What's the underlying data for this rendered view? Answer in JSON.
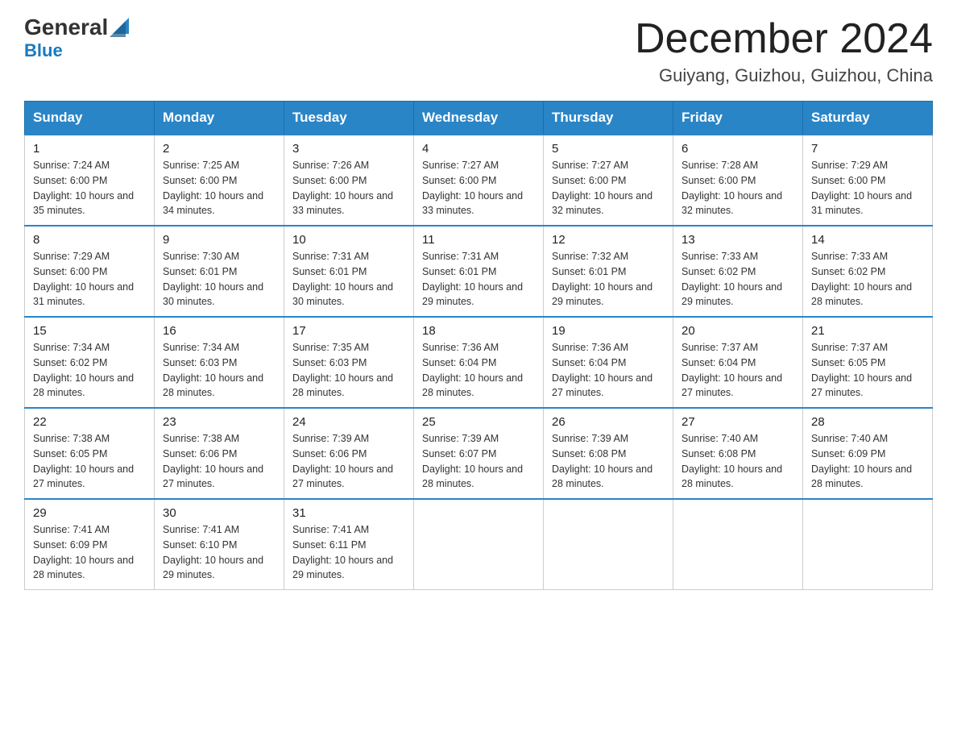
{
  "header": {
    "logo_general": "General",
    "logo_blue": "Blue",
    "month_title": "December 2024",
    "location": "Guiyang, Guizhou, Guizhou, China"
  },
  "days_of_week": [
    "Sunday",
    "Monday",
    "Tuesday",
    "Wednesday",
    "Thursday",
    "Friday",
    "Saturday"
  ],
  "weeks": [
    [
      {
        "day": "1",
        "sunrise": "7:24 AM",
        "sunset": "6:00 PM",
        "daylight": "10 hours and 35 minutes."
      },
      {
        "day": "2",
        "sunrise": "7:25 AM",
        "sunset": "6:00 PM",
        "daylight": "10 hours and 34 minutes."
      },
      {
        "day": "3",
        "sunrise": "7:26 AM",
        "sunset": "6:00 PM",
        "daylight": "10 hours and 33 minutes."
      },
      {
        "day": "4",
        "sunrise": "7:27 AM",
        "sunset": "6:00 PM",
        "daylight": "10 hours and 33 minutes."
      },
      {
        "day": "5",
        "sunrise": "7:27 AM",
        "sunset": "6:00 PM",
        "daylight": "10 hours and 32 minutes."
      },
      {
        "day": "6",
        "sunrise": "7:28 AM",
        "sunset": "6:00 PM",
        "daylight": "10 hours and 32 minutes."
      },
      {
        "day": "7",
        "sunrise": "7:29 AM",
        "sunset": "6:00 PM",
        "daylight": "10 hours and 31 minutes."
      }
    ],
    [
      {
        "day": "8",
        "sunrise": "7:29 AM",
        "sunset": "6:00 PM",
        "daylight": "10 hours and 31 minutes."
      },
      {
        "day": "9",
        "sunrise": "7:30 AM",
        "sunset": "6:01 PM",
        "daylight": "10 hours and 30 minutes."
      },
      {
        "day": "10",
        "sunrise": "7:31 AM",
        "sunset": "6:01 PM",
        "daylight": "10 hours and 30 minutes."
      },
      {
        "day": "11",
        "sunrise": "7:31 AM",
        "sunset": "6:01 PM",
        "daylight": "10 hours and 29 minutes."
      },
      {
        "day": "12",
        "sunrise": "7:32 AM",
        "sunset": "6:01 PM",
        "daylight": "10 hours and 29 minutes."
      },
      {
        "day": "13",
        "sunrise": "7:33 AM",
        "sunset": "6:02 PM",
        "daylight": "10 hours and 29 minutes."
      },
      {
        "day": "14",
        "sunrise": "7:33 AM",
        "sunset": "6:02 PM",
        "daylight": "10 hours and 28 minutes."
      }
    ],
    [
      {
        "day": "15",
        "sunrise": "7:34 AM",
        "sunset": "6:02 PM",
        "daylight": "10 hours and 28 minutes."
      },
      {
        "day": "16",
        "sunrise": "7:34 AM",
        "sunset": "6:03 PM",
        "daylight": "10 hours and 28 minutes."
      },
      {
        "day": "17",
        "sunrise": "7:35 AM",
        "sunset": "6:03 PM",
        "daylight": "10 hours and 28 minutes."
      },
      {
        "day": "18",
        "sunrise": "7:36 AM",
        "sunset": "6:04 PM",
        "daylight": "10 hours and 28 minutes."
      },
      {
        "day": "19",
        "sunrise": "7:36 AM",
        "sunset": "6:04 PM",
        "daylight": "10 hours and 27 minutes."
      },
      {
        "day": "20",
        "sunrise": "7:37 AM",
        "sunset": "6:04 PM",
        "daylight": "10 hours and 27 minutes."
      },
      {
        "day": "21",
        "sunrise": "7:37 AM",
        "sunset": "6:05 PM",
        "daylight": "10 hours and 27 minutes."
      }
    ],
    [
      {
        "day": "22",
        "sunrise": "7:38 AM",
        "sunset": "6:05 PM",
        "daylight": "10 hours and 27 minutes."
      },
      {
        "day": "23",
        "sunrise": "7:38 AM",
        "sunset": "6:06 PM",
        "daylight": "10 hours and 27 minutes."
      },
      {
        "day": "24",
        "sunrise": "7:39 AM",
        "sunset": "6:06 PM",
        "daylight": "10 hours and 27 minutes."
      },
      {
        "day": "25",
        "sunrise": "7:39 AM",
        "sunset": "6:07 PM",
        "daylight": "10 hours and 28 minutes."
      },
      {
        "day": "26",
        "sunrise": "7:39 AM",
        "sunset": "6:08 PM",
        "daylight": "10 hours and 28 minutes."
      },
      {
        "day": "27",
        "sunrise": "7:40 AM",
        "sunset": "6:08 PM",
        "daylight": "10 hours and 28 minutes."
      },
      {
        "day": "28",
        "sunrise": "7:40 AM",
        "sunset": "6:09 PM",
        "daylight": "10 hours and 28 minutes."
      }
    ],
    [
      {
        "day": "29",
        "sunrise": "7:41 AM",
        "sunset": "6:09 PM",
        "daylight": "10 hours and 28 minutes."
      },
      {
        "day": "30",
        "sunrise": "7:41 AM",
        "sunset": "6:10 PM",
        "daylight": "10 hours and 29 minutes."
      },
      {
        "day": "31",
        "sunrise": "7:41 AM",
        "sunset": "6:11 PM",
        "daylight": "10 hours and 29 minutes."
      },
      null,
      null,
      null,
      null
    ]
  ]
}
